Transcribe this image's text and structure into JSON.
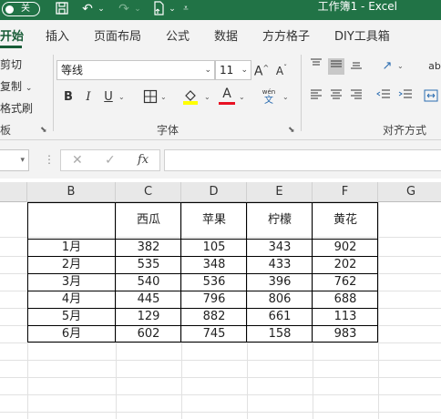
{
  "window": {
    "autosave_label": "关",
    "title": "工作簿1  -  Excel"
  },
  "tabs": [
    {
      "label": "开始",
      "active": true
    },
    {
      "label": "插入"
    },
    {
      "label": "页面布局"
    },
    {
      "label": "公式"
    },
    {
      "label": "数据"
    },
    {
      "label": "方方格子"
    },
    {
      "label": "DIY工具箱"
    }
  ],
  "clipboard": {
    "cut": "剪切",
    "copy": "复制",
    "format_painter": "格式刷",
    "group_label": "板"
  },
  "font": {
    "font_name": "等线",
    "font_size": "11",
    "bold": "B",
    "italic": "I",
    "underline": "U",
    "font_color_glyph": "A",
    "wen_top": "wén",
    "wen_bottom": "文",
    "group_label": "字体"
  },
  "alignment": {
    "group_label": "对齐方式",
    "wrap_glyph": "ab"
  },
  "formula_bar": {
    "fx": "fx",
    "value": ""
  },
  "columns": [
    "B",
    "C",
    "D",
    "E",
    "F",
    "G"
  ],
  "table": {
    "headers": [
      "",
      "西瓜",
      "苹果",
      "柠檬",
      "黄花"
    ],
    "rows": [
      {
        "label": "1月",
        "values": [
          "382",
          "105",
          "343",
          "902"
        ]
      },
      {
        "label": "2月",
        "values": [
          "535",
          "348",
          "433",
          "202"
        ]
      },
      {
        "label": "3月",
        "values": [
          "540",
          "536",
          "396",
          "762"
        ]
      },
      {
        "label": "4月",
        "values": [
          "445",
          "796",
          "806",
          "688"
        ]
      },
      {
        "label": "5月",
        "values": [
          "129",
          "882",
          "661",
          "113"
        ]
      },
      {
        "label": "6月",
        "values": [
          "602",
          "745",
          "158",
          "983"
        ]
      }
    ]
  },
  "colors": {
    "excel_green": "#217346",
    "active_tab": "#185c37",
    "highlight": "#ffff00",
    "font_color": "#e81123"
  }
}
